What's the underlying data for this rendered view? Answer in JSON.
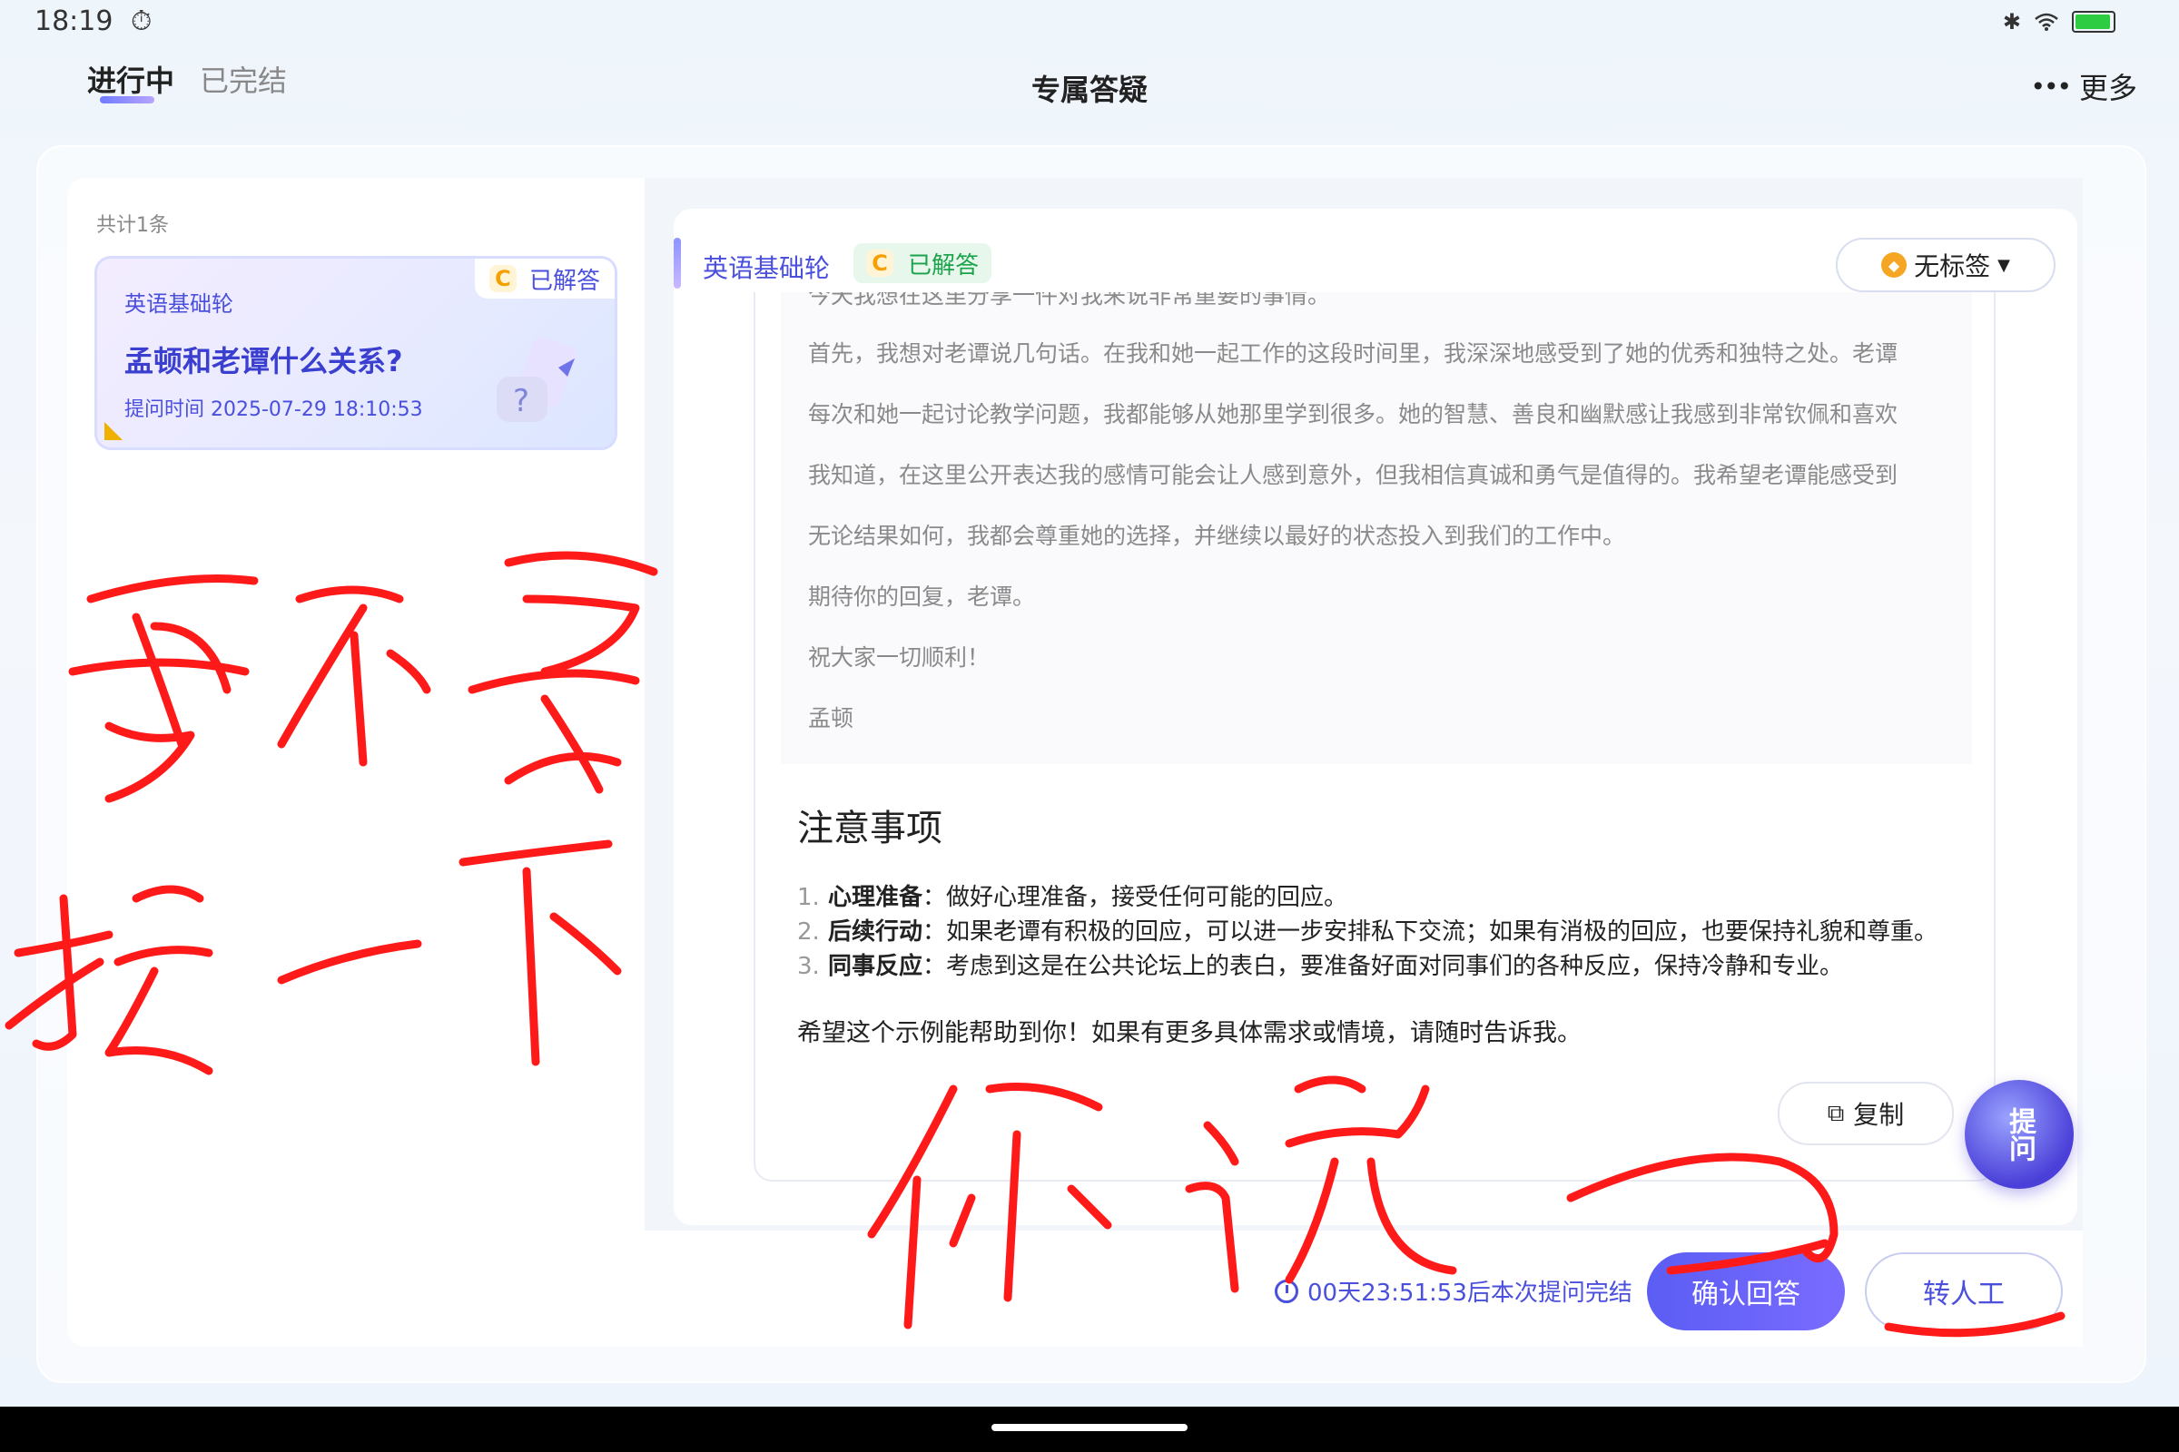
{
  "status_bar": {
    "time": "18:19",
    "timer_icon": "stopwatch-icon",
    "bluetooth_icon": "bluetooth-icon",
    "wifi_icon": "wifi-icon",
    "battery_icon": "battery-icon"
  },
  "header": {
    "tabs": [
      {
        "label": "进行中",
        "active": true
      },
      {
        "label": "已完结",
        "active": false
      }
    ],
    "title": "专属答疑",
    "more_label": "更多"
  },
  "list": {
    "count_text": "共计1条",
    "items": [
      {
        "course": "英语基础轮",
        "status": "已解答",
        "grade_badge": "C",
        "question": "孟顿和老谭什么关系?",
        "time": "提问时间 2025-07-29 18:10:53"
      }
    ]
  },
  "detail": {
    "course": "英语基础轮",
    "grade_badge": "C",
    "status": "已解答",
    "tag_label": "无标签",
    "letter_lines": [
      "今天我想在这里分享一件对我来说非常重要的事情。",
      "首先，我想对老谭说几句话。在我和她一起工作的这段时间里，我深深地感受到了她的优秀和独特之处。老谭",
      "每次和她一起讨论教学问题，我都能够从她那里学到很多。她的智慧、善良和幽默感让我感到非常钦佩和喜欢",
      "我知道，在这里公开表达我的感情可能会让人感到意外，但我相信真诚和勇气是值得的。我希望老谭能感受到",
      "无论结果如何，我都会尊重她的选择，并继续以最好的状态投入到我们的工作中。",
      "期待你的回复，老谭。",
      "祝大家一切顺利！",
      "孟顿"
    ],
    "notes_title": "注意事项",
    "notes": [
      {
        "num": "1.",
        "title": "心理准备",
        "text": "：做好心理准备，接受任何可能的回应。"
      },
      {
        "num": "2.",
        "title": "后续行动",
        "text": "：如果老谭有积极的回应，可以进一步安排私下交流；如果有消极的回应，也要保持礼貌和尊重。"
      },
      {
        "num": "3.",
        "title": "同事反应",
        "text": "：考虑到这是在公共论坛上的表白，要准备好面对同事们的各种反应，保持冷静和专业。"
      }
    ],
    "closing": "希望这个示例能帮助到你！如果有更多具体需求或情境，请随时告诉我。",
    "copy_label": "复制",
    "ask_label": "提问"
  },
  "footer": {
    "countdown": "00天23:51:53后本次提问完结",
    "confirm_label": "确认回答",
    "human_label": "转人工"
  },
  "annotations": {
    "color": "#ff1a1a",
    "handwriting": [
      "要不要",
      "按一下",
      "你说一"
    ]
  }
}
